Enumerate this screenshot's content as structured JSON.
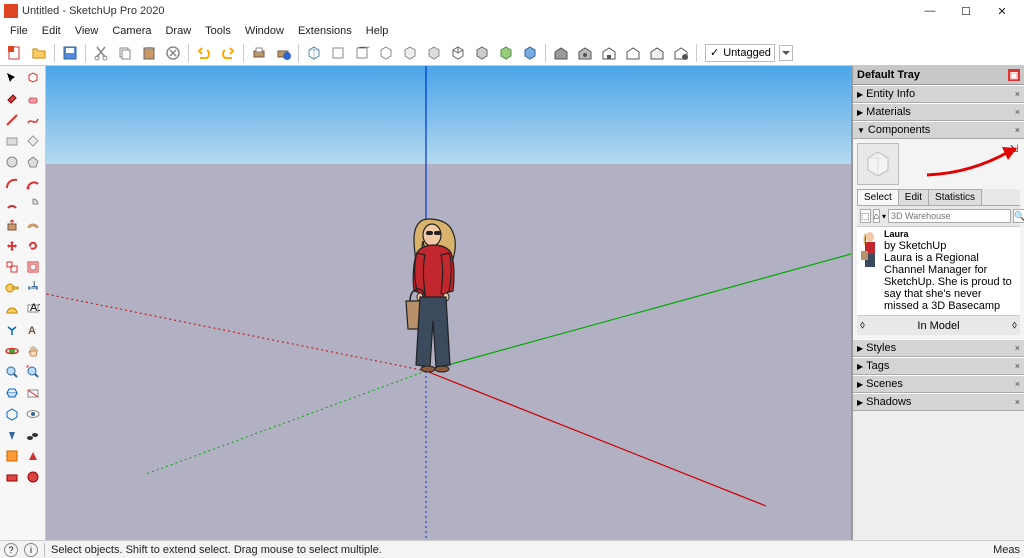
{
  "title": "Untitled - SketchUp Pro 2020",
  "menus": [
    "File",
    "Edit",
    "View",
    "Camera",
    "Draw",
    "Tools",
    "Window",
    "Extensions",
    "Help"
  ],
  "tag_dropdown": {
    "check": "✓",
    "label": "Untagged"
  },
  "tray": {
    "title": "Default Tray",
    "panels": {
      "entity": "Entity Info",
      "materials": "Materials",
      "components": "Components",
      "styles": "Styles",
      "tags": "Tags",
      "scenes": "Scenes",
      "shadows": "Shadows"
    },
    "components": {
      "tabs": {
        "select": "Select",
        "edit": "Edit",
        "stats": "Statistics"
      },
      "search": {
        "placeholder": "3D Warehouse"
      },
      "laura": {
        "name": "Laura",
        "by": "by SketchUp",
        "desc": "Laura is a Regional Channel Manager for SketchUp. She is proud to say that she's never missed a 3D Basecamp"
      },
      "in_model": "In Model"
    }
  },
  "status": {
    "hint": "Select objects. Shift to extend select. Drag mouse to select multiple.",
    "measure": "Meas"
  },
  "win_controls": {
    "min": "—",
    "max": "☐",
    "close": "✕"
  }
}
